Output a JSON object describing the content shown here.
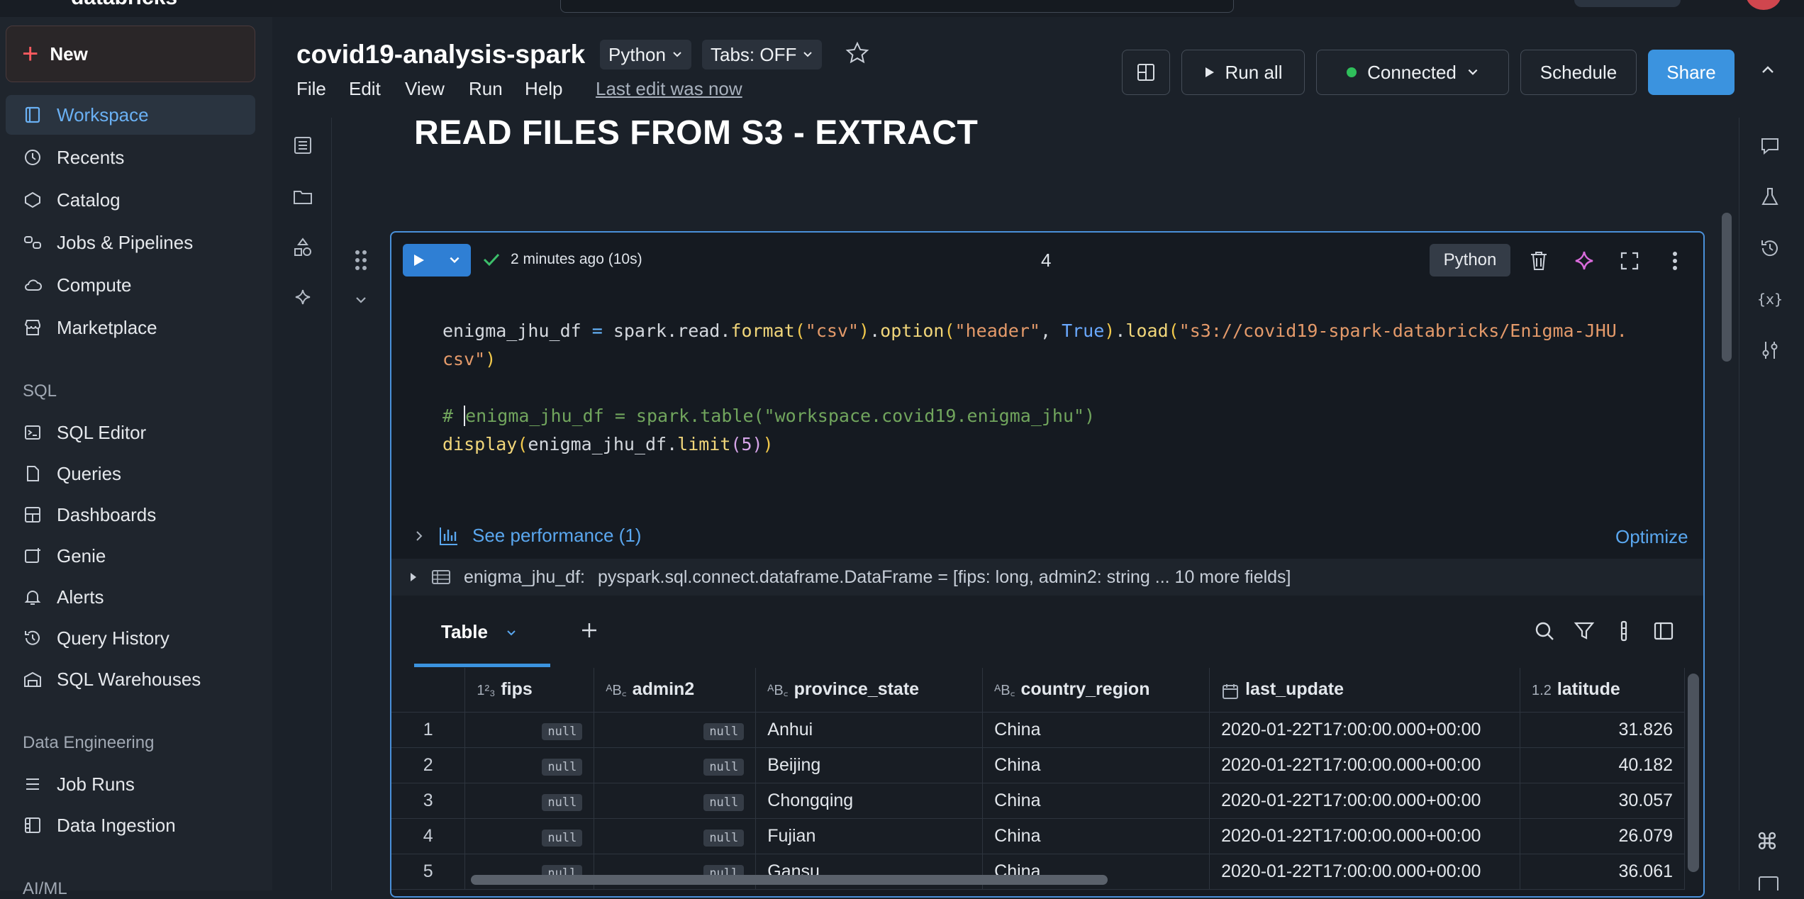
{
  "app": {
    "brand": "databricks"
  },
  "sidebar": {
    "new_label": "New",
    "items": [
      {
        "label": "Workspace",
        "icon": "workspace-icon",
        "active": true
      },
      {
        "label": "Recents",
        "icon": "clock-icon"
      },
      {
        "label": "Catalog",
        "icon": "catalog-icon"
      },
      {
        "label": "Jobs & Pipelines",
        "icon": "jobs-icon"
      },
      {
        "label": "Compute",
        "icon": "cloud-icon"
      },
      {
        "label": "Marketplace",
        "icon": "store-icon"
      }
    ],
    "sql_section": "SQL",
    "sql_items": [
      {
        "label": "SQL Editor",
        "icon": "sql-editor-icon"
      },
      {
        "label": "Queries",
        "icon": "queries-icon"
      },
      {
        "label": "Dashboards",
        "icon": "dashboards-icon"
      },
      {
        "label": "Genie",
        "icon": "genie-icon"
      },
      {
        "label": "Alerts",
        "icon": "bell-icon"
      },
      {
        "label": "Query History",
        "icon": "history-icon"
      },
      {
        "label": "SQL Warehouses",
        "icon": "warehouse-icon"
      }
    ],
    "de_section": "Data Engineering",
    "de_items": [
      {
        "label": "Job Runs",
        "icon": "job-runs-icon"
      },
      {
        "label": "Data Ingestion",
        "icon": "ingestion-icon"
      }
    ],
    "next_section_cut": "AI/ML"
  },
  "header": {
    "title": "covid19-analysis-spark",
    "language": "Python",
    "tabs": "Tabs: OFF",
    "menu": [
      "File",
      "Edit",
      "View",
      "Run",
      "Help"
    ],
    "last_edit": "Last edit was now",
    "run_all": "Run all",
    "connected": "Connected",
    "schedule": "Schedule",
    "share": "Share"
  },
  "content": {
    "heading": "READ FILES FROM S3 - EXTRACT",
    "cell": {
      "status": "2 minutes ago (10s)",
      "number": "4",
      "language": "Python",
      "see_performance": "See performance (1)",
      "optimize": "Optimize",
      "df_name": "enigma_jhu_df:",
      "df_type": "pyspark.sql.connect.dataframe.DataFrame = [fips: long, admin2: string ... 10 more fields]",
      "result_tab": "Table"
    }
  },
  "table": {
    "columns": [
      {
        "name": "fips",
        "type_icon": "1²₃"
      },
      {
        "name": "admin2",
        "type_icon": "ᴬB꜀"
      },
      {
        "name": "province_state",
        "type_icon": "ᴬB꜀"
      },
      {
        "name": "country_region",
        "type_icon": "ᴬB꜀"
      },
      {
        "name": "last_update",
        "type_icon": "calendar"
      },
      {
        "name": "latitude",
        "type_icon": "1.2"
      }
    ],
    "rows": [
      {
        "n": "1",
        "fips": "null",
        "admin2": "null",
        "province_state": "Anhui",
        "country_region": "China",
        "last_update": "2020-01-22T17:00:00.000+00:00",
        "latitude": "31.826"
      },
      {
        "n": "2",
        "fips": "null",
        "admin2": "null",
        "province_state": "Beijing",
        "country_region": "China",
        "last_update": "2020-01-22T17:00:00.000+00:00",
        "latitude": "40.182"
      },
      {
        "n": "3",
        "fips": "null",
        "admin2": "null",
        "province_state": "Chongqing",
        "country_region": "China",
        "last_update": "2020-01-22T17:00:00.000+00:00",
        "latitude": "30.057"
      },
      {
        "n": "4",
        "fips": "null",
        "admin2": "null",
        "province_state": "Fujian",
        "country_region": "China",
        "last_update": "2020-01-22T17:00:00.000+00:00",
        "latitude": "26.079"
      },
      {
        "n": "5",
        "fips": "null",
        "admin2": "null",
        "province_state": "Gansu",
        "country_region": "China",
        "last_update": "2020-01-22T17:00:00.000+00:00",
        "latitude": "36.061"
      }
    ]
  },
  "colors": {
    "accent": "#3b93df",
    "new_plus": "#ff5a5f",
    "connected_dot": "#2fbf5b",
    "ai_star": "#d96bdb"
  }
}
